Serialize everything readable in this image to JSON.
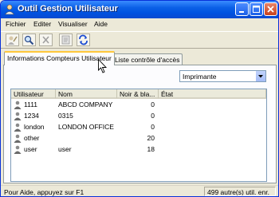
{
  "window": {
    "title": "Outil Gestion Utilisateur"
  },
  "menu": [
    "Fichier",
    "Editer",
    "Visualiser",
    "Aide"
  ],
  "toolbar": {
    "icons": [
      "edit-user-icon",
      "search-icon",
      "delete-icon",
      "properties-icon",
      "refresh-icon"
    ]
  },
  "tabs": [
    {
      "label": "Informations Compteurs Utilisateur",
      "active": true
    },
    {
      "label": "Liste contrôle d'accès",
      "active": false
    }
  ],
  "filter": {
    "selected": "Imprimante"
  },
  "table": {
    "columns": [
      "Utilisateur",
      "Nom",
      "Noir & bla...",
      "État"
    ],
    "rows": [
      {
        "user": "1111",
        "name": "ABCD COMPANY",
        "count": "0"
      },
      {
        "user": "1234",
        "name": "0315",
        "count": "0"
      },
      {
        "user": "london",
        "name": "LONDON OFFICE",
        "count": "0"
      },
      {
        "user": "other",
        "name": "",
        "count": "20"
      },
      {
        "user": "user",
        "name": "user",
        "count": "18"
      }
    ]
  },
  "status": {
    "help": "Pour Aide, appuyez sur F1",
    "count": "499 autre(s) util. enr."
  },
  "colors": {
    "titlebar": "#0a5fe6",
    "active_tab_accent": "#ffc83c"
  }
}
